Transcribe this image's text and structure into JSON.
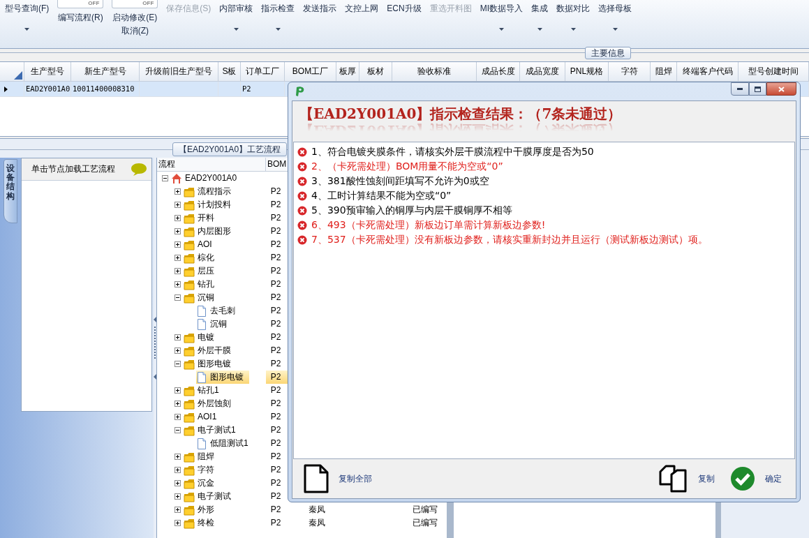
{
  "toolbar": [
    {
      "label": "型号查询(F)",
      "dropdown": true,
      "disabled": false
    },
    {
      "label": "编写流程(R)",
      "toggle": "OFF",
      "on": false,
      "dropdown": false,
      "disabled": false
    },
    {
      "label": "启动修改(E)",
      "toggle": "OFF",
      "on": false,
      "sublabel": "取消(Z)",
      "dropdown": false,
      "disabled": false
    },
    {
      "label": "保存信息(S)",
      "dropdown": false,
      "disabled": true
    },
    {
      "label": "内部审核",
      "dropdown": true,
      "disabled": false
    },
    {
      "label": "指示检查",
      "dropdown": true,
      "disabled": false
    },
    {
      "label": "发送指示",
      "dropdown": false,
      "disabled": false
    },
    {
      "label": "文控上网",
      "dropdown": false,
      "disabled": false
    },
    {
      "label": "ECN升级",
      "dropdown": false,
      "disabled": false
    },
    {
      "label": "重选开料图",
      "dropdown": false,
      "disabled": true
    },
    {
      "label": "MI数据导入",
      "dropdown": true,
      "disabled": false
    },
    {
      "label": "集成",
      "dropdown": true,
      "disabled": false
    },
    {
      "label": "数据对比",
      "dropdown": true,
      "disabled": false
    },
    {
      "label": "选择母板",
      "dropdown": true,
      "disabled": false
    }
  ],
  "main_info": {
    "title": "主要信息",
    "columns": [
      "生产型号",
      "新生产型号",
      "升级前旧生产型号",
      "S板",
      "订单工厂",
      "BOM工厂",
      "板厚",
      "板材",
      "验收标准",
      "成品长度",
      "成品宽度",
      "PNL规格",
      "字符",
      "阻焊",
      "终端客户代码",
      "型号创建时间"
    ],
    "rows": [
      {
        "selected": true,
        "cells": [
          "EAD2Y001A0",
          "10011400008310",
          null,
          null,
          "P2"
        ]
      }
    ]
  },
  "process": {
    "tab": "【EAD2Y001A0】工艺流程",
    "side_tab": "设备结构",
    "hint": "单击节点加载工艺流程",
    "tree_columns": [
      "流程",
      "BOM"
    ],
    "tree": [
      {
        "label": "EAD2Y001A0",
        "kind": "home",
        "expanded": true,
        "selected": false,
        "children": [
          {
            "label": "流程指示",
            "kind": "folder",
            "expanded": false,
            "selected": false,
            "bom": "P2"
          },
          {
            "label": "计划投料",
            "kind": "folder",
            "expanded": false,
            "selected": false,
            "bom": "P2"
          },
          {
            "label": "开料",
            "kind": "folder",
            "expanded": false,
            "selected": false,
            "bom": "P2"
          },
          {
            "label": "内层图形",
            "kind": "folder",
            "expanded": false,
            "selected": false,
            "bom": "P2"
          },
          {
            "label": "AOI",
            "kind": "folder",
            "expanded": false,
            "selected": false,
            "bom": "P2"
          },
          {
            "label": "棕化",
            "kind": "folder",
            "expanded": false,
            "selected": false,
            "bom": "P2"
          },
          {
            "label": "层压",
            "kind": "folder",
            "expanded": false,
            "selected": false,
            "bom": "P2"
          },
          {
            "label": "钻孔",
            "kind": "folder",
            "expanded": false,
            "selected": false,
            "bom": "P2"
          },
          {
            "label": "沉铜",
            "kind": "folder",
            "expanded": true,
            "selected": false,
            "bom": "P2",
            "children": [
              {
                "label": "去毛刺",
                "kind": "document",
                "selected": false,
                "bom": "P2"
              },
              {
                "label": "沉铜",
                "kind": "document",
                "selected": false,
                "bom": "P2"
              }
            ]
          },
          {
            "label": "电镀",
            "kind": "folder",
            "expanded": false,
            "selected": false,
            "bom": "P2"
          },
          {
            "label": "外层干膜",
            "kind": "folder",
            "expanded": false,
            "selected": false,
            "bom": "P2"
          },
          {
            "label": "图形电镀",
            "kind": "folder",
            "expanded": true,
            "selected": false,
            "bom": "P2",
            "children": [
              {
                "label": "图形电镀",
                "kind": "document",
                "selected": true,
                "bom": "P2"
              }
            ]
          },
          {
            "label": "钻孔1",
            "kind": "folder",
            "expanded": false,
            "selected": false,
            "bom": "P2"
          },
          {
            "label": "外层蚀刻",
            "kind": "folder",
            "expanded": false,
            "selected": false,
            "bom": "P2"
          },
          {
            "label": "AOI1",
            "kind": "folder",
            "expanded": false,
            "selected": false,
            "bom": "P2"
          },
          {
            "label": "电子测试1",
            "kind": "folder",
            "expanded": true,
            "selected": false,
            "bom": "P2",
            "children": [
              {
                "label": "低阻测试1",
                "kind": "document",
                "selected": false,
                "bom": "P2"
              }
            ]
          },
          {
            "label": "阻焊",
            "kind": "folder",
            "expanded": false,
            "selected": false,
            "bom": "P2"
          },
          {
            "label": "字符",
            "kind": "folder",
            "expanded": false,
            "selected": false,
            "bom": "P2"
          },
          {
            "label": "沉金",
            "kind": "folder",
            "expanded": false,
            "selected": false,
            "bom": "P2"
          },
          {
            "label": "电子测试",
            "kind": "folder",
            "expanded": false,
            "selected": false,
            "bom": "P2"
          },
          {
            "label": "外形",
            "kind": "folder",
            "expanded": false,
            "selected": false,
            "bom": "P2",
            "column_3": "秦凤",
            "column_5": "已编写"
          },
          {
            "label": "终检",
            "kind": "folder",
            "expanded": false,
            "selected": false,
            "bom": "P2",
            "column_3": "秦凤",
            "column_5": "已编写"
          }
        ]
      }
    ]
  },
  "dialog": {
    "heading": "【EAD2Y001A0】指示检查结果：（7条未通过）",
    "messages": [
      {
        "text": "1、符合电镀夹膜条件，请核实外层干膜流程中干膜厚度是否为50",
        "color": "#000000"
      },
      {
        "text": "2、（卡死需处理）BOM用量不能为空或“0”",
        "color": "#e0201c"
      },
      {
        "text": "3、381酸性蚀刻间距填写不允许为0或空",
        "color": "#000000"
      },
      {
        "text": "4、工时计算结果不能为空或“0”",
        "color": "#000000"
      },
      {
        "text": "5、390预审输入的铜厚与内层干膜铜厚不相等",
        "color": "#000000"
      },
      {
        "text": "6、493（卡死需处理）新板边订单需计算新板边参数!",
        "color": "#e0201c"
      },
      {
        "text": "7、537（卡死需处理）没有新板边参数，请核实重新封边并且运行（测试新板边测试）项。",
        "color": "#e0201c"
      }
    ],
    "actions": [
      {
        "kind": "copy_all",
        "label": "复制全部"
      },
      {
        "kind": "copy",
        "label": "复制"
      },
      {
        "kind": "ok",
        "label": "确定"
      }
    ]
  }
}
